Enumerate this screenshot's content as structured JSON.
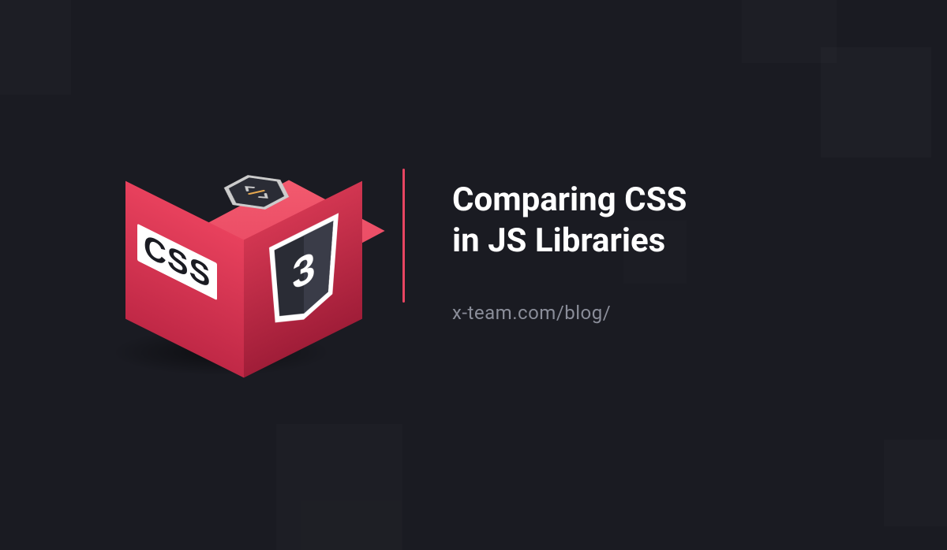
{
  "title_line1": "Comparing CSS",
  "title_line2": "in JS Libraries",
  "url": "x-team.com/blog/",
  "cube": {
    "left_label": "CSS",
    "right_label": "3"
  },
  "colors": {
    "accent": "#e74561",
    "bg": "#1a1b22"
  }
}
